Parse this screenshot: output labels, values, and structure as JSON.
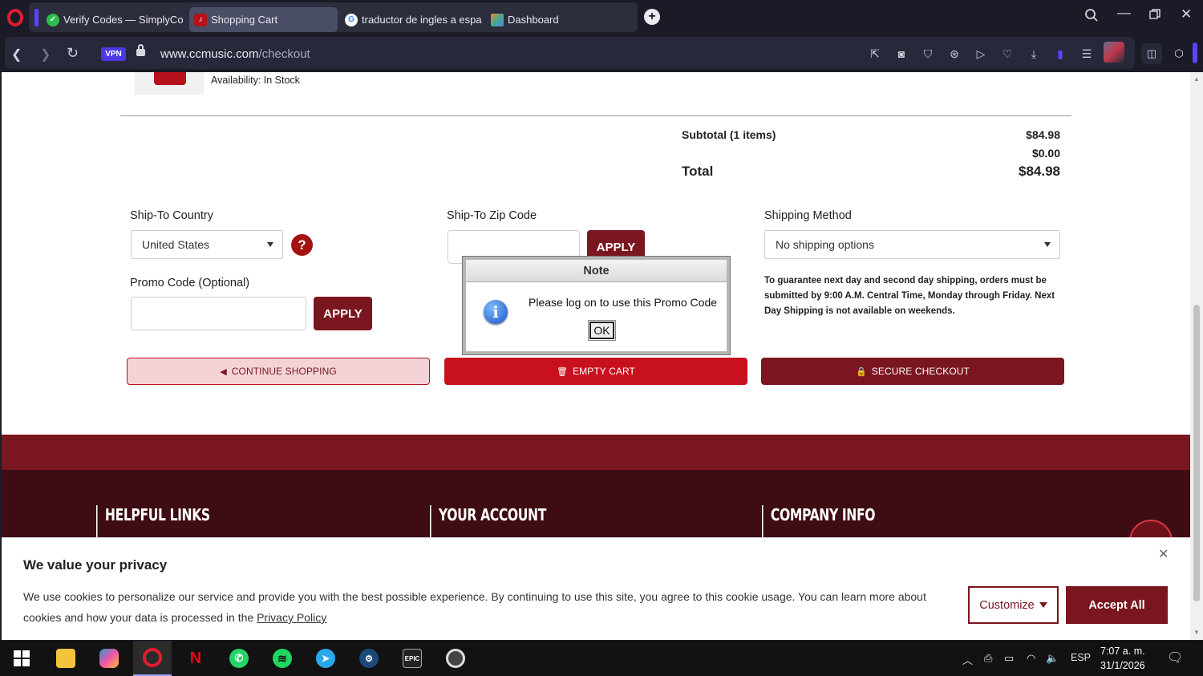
{
  "browser": {
    "tabs": [
      {
        "label": "Verify Codes — SimplyCo",
        "icon": "simplycodes-favicon",
        "active": false
      },
      {
        "label": "Shopping Cart",
        "icon": "ccmusic-favicon",
        "active": true
      },
      {
        "label": "traductor de ingles a espa",
        "icon": "google-favicon",
        "active": false
      },
      {
        "label": "Dashboard",
        "icon": "dashboard-favicon",
        "active": false
      }
    ],
    "vpn_label": "VPN",
    "url_host": "www.ccmusic.com",
    "url_path": "/checkout"
  },
  "cart": {
    "availability": "Availability: In Stock",
    "subtotal_label": "Subtotal (1 items)",
    "subtotal_value": "$84.98",
    "shipping_value": "$0.00",
    "total_label": "Total",
    "total_value": "$84.98"
  },
  "shipping": {
    "country_label": "Ship-To Country",
    "country_value": "United States",
    "zip_label": "Ship-To Zip Code",
    "zip_value": "",
    "zip_apply": "APPLY",
    "method_label": "Shipping Method",
    "method_value": "No shipping options",
    "note": "To guarantee next day and second day shipping, orders must be submitted by 9:00 A.M. Central Time, Monday through Friday. Next Day Shipping is not available on weekends."
  },
  "promo": {
    "label": "Promo Code (Optional)",
    "value": "",
    "apply": "APPLY"
  },
  "actions": {
    "continue": "CONTINUE SHOPPING",
    "empty": "EMPTY CART",
    "secure": "SECURE CHECKOUT"
  },
  "footer": {
    "col1": "HELPFUL LINKS",
    "col2": "YOUR ACCOUNT",
    "col3": "COMPANY INFO"
  },
  "dialog": {
    "title": "Note",
    "message": "Please log on to use this Promo Code",
    "ok": "OK"
  },
  "cookie": {
    "title": "We value your privacy",
    "text": "We use cookies to personalize our service and provide you with the best possible experience. By continuing to use this site, you agree to this cookie usage. You can learn more about cookies and how your data is processed in the",
    "link": "Privacy Policy",
    "customize": "Customize",
    "accept": "Accept All"
  },
  "taskbar": {
    "lang": "ESP",
    "time": "7:07 a. m.",
    "date": "31/1/2026"
  },
  "colors": {
    "brand": "#7a1620",
    "brand_bright": "#c8101e",
    "footer_dark": "#3e0c13",
    "browser_bg": "#1a1b27"
  }
}
